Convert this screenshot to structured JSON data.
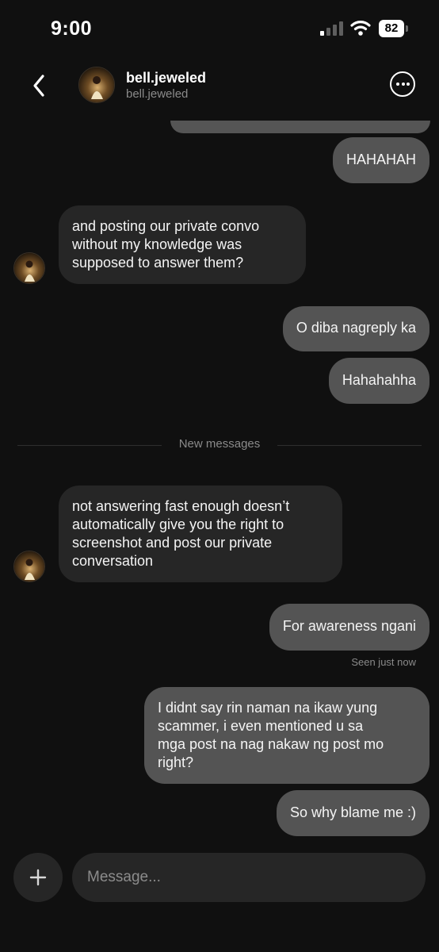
{
  "status_bar": {
    "time": "9:00",
    "battery": "82",
    "icons": [
      "signal-icon",
      "wifi-icon",
      "battery-icon"
    ]
  },
  "header": {
    "name": "bell.jeweled",
    "username": "bell.jeweled",
    "icons": [
      "back-arrow-icon",
      "more-options-icon"
    ]
  },
  "chat": {
    "messages_before": [
      {
        "from": "me",
        "text": "HAHAHAH"
      },
      {
        "from": "them",
        "text": "and posting our private convo\nwithout my knowledge was\nsupposed to answer them?"
      },
      {
        "from": "me",
        "text": "O diba nagreply ka"
      },
      {
        "from": "me",
        "text": "Hahahahha"
      }
    ],
    "divider_label": "New messages",
    "messages_after": [
      {
        "from": "them",
        "text": "not answering fast enough doesn’t\nautomatically give you the right to\nscreenshot and post our private\nconversation"
      },
      {
        "from": "me",
        "text": "For awareness ngani"
      },
      {
        "from": "me",
        "text": "I didnt say rin naman na ikaw yung\nscammer, i even mentioned u sa\nmga post na nag nakaw ng post mo\nright?"
      },
      {
        "from": "me",
        "text": "So why blame me :)"
      }
    ],
    "seen_status": "Seen just now"
  },
  "composer": {
    "placeholder": "Message...",
    "icons": [
      "plus-icon"
    ]
  },
  "colors": {
    "background": "#101010",
    "outgoing_bubble": "#545454",
    "incoming_bubble": "#262626"
  }
}
